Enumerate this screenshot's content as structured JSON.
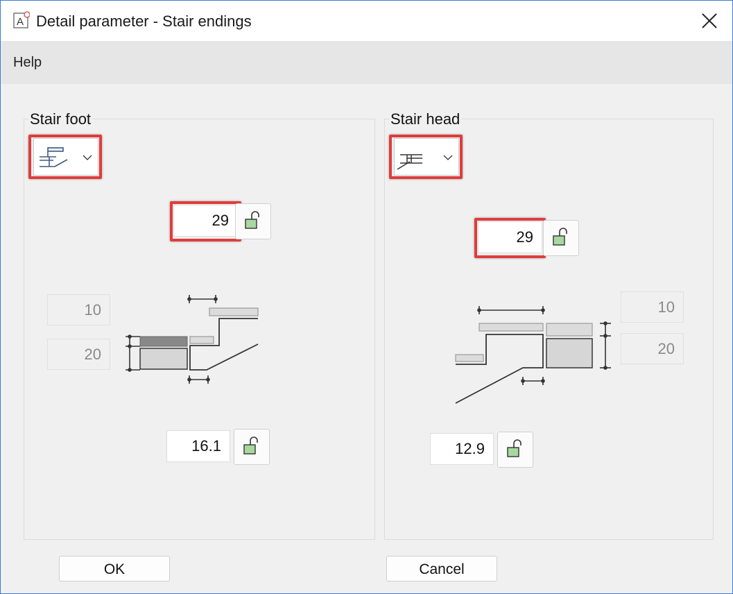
{
  "window": {
    "title": "Detail parameter - Stair endings"
  },
  "menu": {
    "help": "Help"
  },
  "foot": {
    "label": "Stair foot",
    "main_value": "29",
    "dim_top": "10",
    "dim_bottom": "20",
    "width_value": "16.1"
  },
  "head": {
    "label": "Stair head",
    "main_value": "29",
    "dim_top": "10",
    "dim_bottom": "20",
    "width_value": "12.9"
  },
  "buttons": {
    "ok": "OK",
    "cancel": "Cancel"
  },
  "colors": {
    "highlight": "#e03c3c",
    "lock_fill": "#a8d8a0",
    "window_border": "#3a7bd5"
  }
}
